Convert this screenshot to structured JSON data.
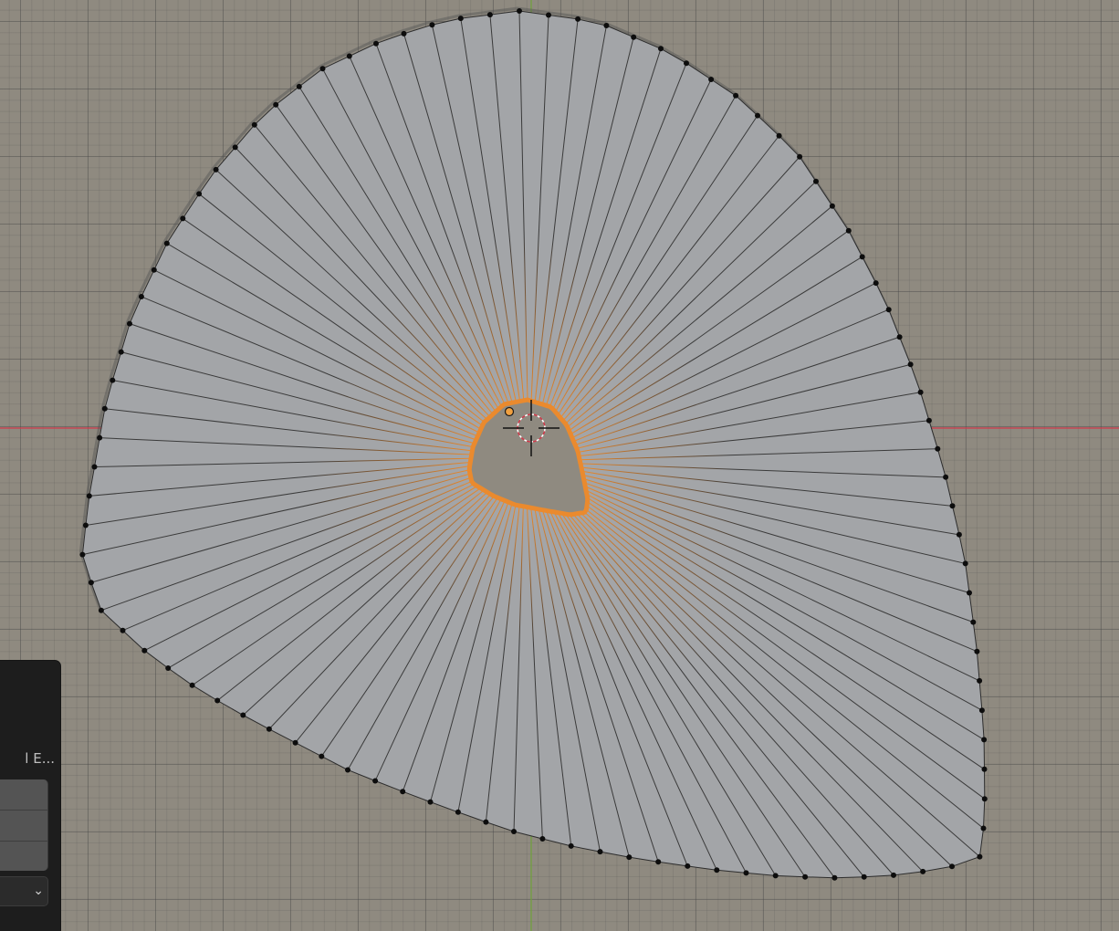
{
  "viewport": {
    "mode": "Edit Mode",
    "colors": {
      "face": "#a3a5a8",
      "edge_unselected": "#3a3a3a",
      "vertex_unselected": "#0d0d0d",
      "selected": "#ea8a2e",
      "axis_x": "#d0394a",
      "axis_y": "#6fa23a"
    },
    "outer_vertex_count": 96,
    "cursor_icon": "3d-cursor-icon",
    "origin_icon": "object-origin-icon"
  },
  "operator_panel": {
    "title": "l E...",
    "fields": [
      "",
      "",
      ""
    ],
    "dropdown_value": "",
    "dropdown_icon": "chevron-down-icon"
  }
}
